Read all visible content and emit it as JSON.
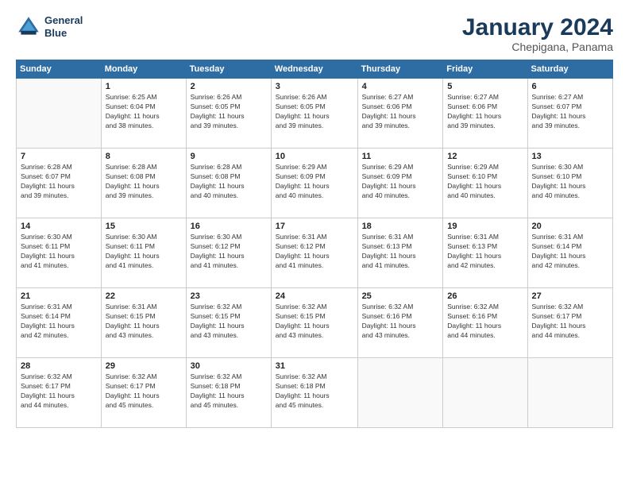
{
  "logo": {
    "line1": "General",
    "line2": "Blue"
  },
  "title": "January 2024",
  "subtitle": "Chepigana, Panama",
  "headers": [
    "Sunday",
    "Monday",
    "Tuesday",
    "Wednesday",
    "Thursday",
    "Friday",
    "Saturday"
  ],
  "weeks": [
    [
      {
        "day": "",
        "info": ""
      },
      {
        "day": "1",
        "info": "Sunrise: 6:25 AM\nSunset: 6:04 PM\nDaylight: 11 hours\nand 38 minutes."
      },
      {
        "day": "2",
        "info": "Sunrise: 6:26 AM\nSunset: 6:05 PM\nDaylight: 11 hours\nand 39 minutes."
      },
      {
        "day": "3",
        "info": "Sunrise: 6:26 AM\nSunset: 6:05 PM\nDaylight: 11 hours\nand 39 minutes."
      },
      {
        "day": "4",
        "info": "Sunrise: 6:27 AM\nSunset: 6:06 PM\nDaylight: 11 hours\nand 39 minutes."
      },
      {
        "day": "5",
        "info": "Sunrise: 6:27 AM\nSunset: 6:06 PM\nDaylight: 11 hours\nand 39 minutes."
      },
      {
        "day": "6",
        "info": "Sunrise: 6:27 AM\nSunset: 6:07 PM\nDaylight: 11 hours\nand 39 minutes."
      }
    ],
    [
      {
        "day": "7",
        "info": "Sunrise: 6:28 AM\nSunset: 6:07 PM\nDaylight: 11 hours\nand 39 minutes."
      },
      {
        "day": "8",
        "info": "Sunrise: 6:28 AM\nSunset: 6:08 PM\nDaylight: 11 hours\nand 39 minutes."
      },
      {
        "day": "9",
        "info": "Sunrise: 6:28 AM\nSunset: 6:08 PM\nDaylight: 11 hours\nand 40 minutes."
      },
      {
        "day": "10",
        "info": "Sunrise: 6:29 AM\nSunset: 6:09 PM\nDaylight: 11 hours\nand 40 minutes."
      },
      {
        "day": "11",
        "info": "Sunrise: 6:29 AM\nSunset: 6:09 PM\nDaylight: 11 hours\nand 40 minutes."
      },
      {
        "day": "12",
        "info": "Sunrise: 6:29 AM\nSunset: 6:10 PM\nDaylight: 11 hours\nand 40 minutes."
      },
      {
        "day": "13",
        "info": "Sunrise: 6:30 AM\nSunset: 6:10 PM\nDaylight: 11 hours\nand 40 minutes."
      }
    ],
    [
      {
        "day": "14",
        "info": "Sunrise: 6:30 AM\nSunset: 6:11 PM\nDaylight: 11 hours\nand 41 minutes."
      },
      {
        "day": "15",
        "info": "Sunrise: 6:30 AM\nSunset: 6:11 PM\nDaylight: 11 hours\nand 41 minutes."
      },
      {
        "day": "16",
        "info": "Sunrise: 6:30 AM\nSunset: 6:12 PM\nDaylight: 11 hours\nand 41 minutes."
      },
      {
        "day": "17",
        "info": "Sunrise: 6:31 AM\nSunset: 6:12 PM\nDaylight: 11 hours\nand 41 minutes."
      },
      {
        "day": "18",
        "info": "Sunrise: 6:31 AM\nSunset: 6:13 PM\nDaylight: 11 hours\nand 41 minutes."
      },
      {
        "day": "19",
        "info": "Sunrise: 6:31 AM\nSunset: 6:13 PM\nDaylight: 11 hours\nand 42 minutes."
      },
      {
        "day": "20",
        "info": "Sunrise: 6:31 AM\nSunset: 6:14 PM\nDaylight: 11 hours\nand 42 minutes."
      }
    ],
    [
      {
        "day": "21",
        "info": "Sunrise: 6:31 AM\nSunset: 6:14 PM\nDaylight: 11 hours\nand 42 minutes."
      },
      {
        "day": "22",
        "info": "Sunrise: 6:31 AM\nSunset: 6:15 PM\nDaylight: 11 hours\nand 43 minutes."
      },
      {
        "day": "23",
        "info": "Sunrise: 6:32 AM\nSunset: 6:15 PM\nDaylight: 11 hours\nand 43 minutes."
      },
      {
        "day": "24",
        "info": "Sunrise: 6:32 AM\nSunset: 6:15 PM\nDaylight: 11 hours\nand 43 minutes."
      },
      {
        "day": "25",
        "info": "Sunrise: 6:32 AM\nSunset: 6:16 PM\nDaylight: 11 hours\nand 43 minutes."
      },
      {
        "day": "26",
        "info": "Sunrise: 6:32 AM\nSunset: 6:16 PM\nDaylight: 11 hours\nand 44 minutes."
      },
      {
        "day": "27",
        "info": "Sunrise: 6:32 AM\nSunset: 6:17 PM\nDaylight: 11 hours\nand 44 minutes."
      }
    ],
    [
      {
        "day": "28",
        "info": "Sunrise: 6:32 AM\nSunset: 6:17 PM\nDaylight: 11 hours\nand 44 minutes."
      },
      {
        "day": "29",
        "info": "Sunrise: 6:32 AM\nSunset: 6:17 PM\nDaylight: 11 hours\nand 45 minutes."
      },
      {
        "day": "30",
        "info": "Sunrise: 6:32 AM\nSunset: 6:18 PM\nDaylight: 11 hours\nand 45 minutes."
      },
      {
        "day": "31",
        "info": "Sunrise: 6:32 AM\nSunset: 6:18 PM\nDaylight: 11 hours\nand 45 minutes."
      },
      {
        "day": "",
        "info": ""
      },
      {
        "day": "",
        "info": ""
      },
      {
        "day": "",
        "info": ""
      }
    ]
  ]
}
